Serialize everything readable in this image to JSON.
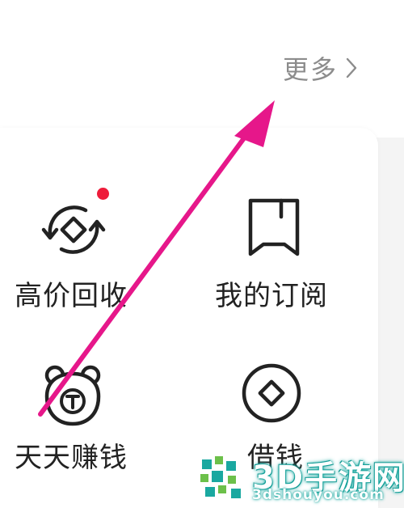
{
  "header": {
    "more_label": "更多",
    "more_icon": "chevron-right-icon"
  },
  "services": [
    {
      "label": "高价回收",
      "icon": "recycle-coin-icon",
      "has_badge": true
    },
    {
      "label": "我的订阅",
      "icon": "bookmark-icon",
      "has_badge": false
    },
    {
      "label": "天天赚钱",
      "icon": "bear-coin-icon",
      "has_badge": false
    },
    {
      "label": "借钱",
      "icon": "coin-icon",
      "has_badge": false
    }
  ],
  "annotation": {
    "arrow_color": "#e6178a"
  },
  "watermark": {
    "title": "3D手游网",
    "url": "3dshouyou.com"
  },
  "colors": {
    "badge": "#ee1c3a",
    "text": "#222222",
    "muted": "#8c8c8c",
    "brand_teal": "#1aa8a0"
  }
}
